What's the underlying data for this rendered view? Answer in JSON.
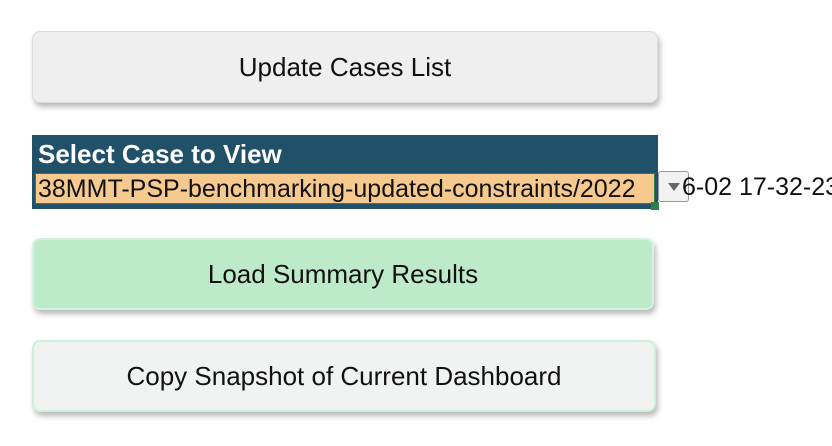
{
  "buttons": {
    "update_cases": "Update Cases List",
    "load_summary": "Load Summary Results",
    "copy_snapshot": "Copy Snapshot of Current Dashboard"
  },
  "case_selector": {
    "header": "Select Case to View",
    "value_visible": "38MMT-PSP-benchmarking-updated-constraints/2022",
    "value_overflow": "6-02 17-32-23",
    "dropdown_icon": "triangle-down-icon"
  },
  "colors": {
    "header_bg": "#215069",
    "selected_value_bg": "#f6c98f",
    "load_button_bg": "#bdebc9",
    "update_button_bg": "#efefef",
    "copy_button_bg": "#f1f3f2"
  }
}
